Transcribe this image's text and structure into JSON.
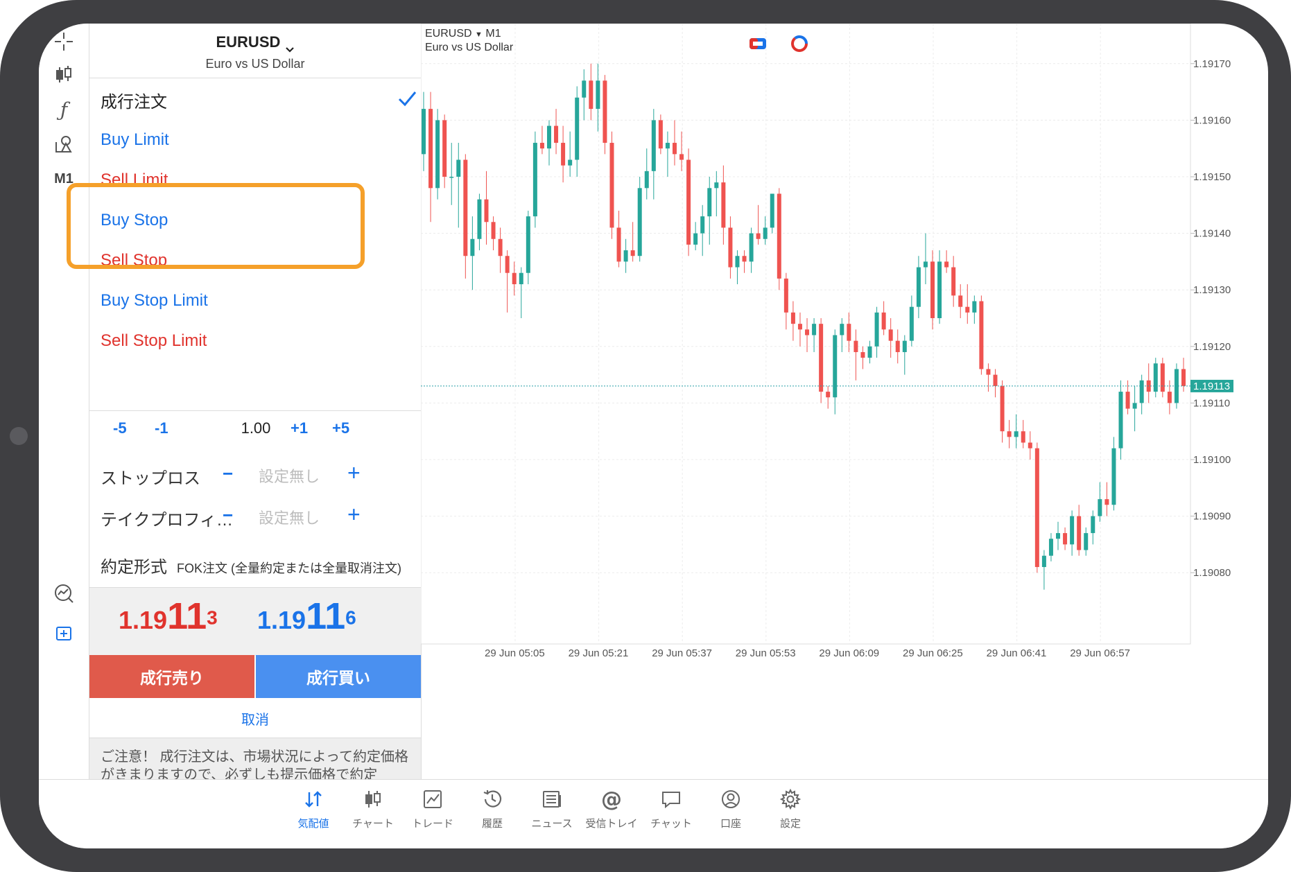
{
  "symbol": {
    "name": "EURUSD",
    "description": "Euro vs US Dollar"
  },
  "order_types": [
    {
      "label": "成行注文",
      "color": "dark",
      "selected": true
    },
    {
      "label": "Buy Limit",
      "color": "blue"
    },
    {
      "label": "Sell Limit",
      "color": "red"
    },
    {
      "label": "Buy Stop",
      "color": "blue"
    },
    {
      "label": "Sell Stop",
      "color": "red"
    },
    {
      "label": "Buy Stop Limit",
      "color": "blue"
    },
    {
      "label": "Sell Stop Limit",
      "color": "red"
    }
  ],
  "volume": {
    "minus5": "-5",
    "minus1": "-1",
    "value": "1.00",
    "plus1": "+1",
    "plus5": "+5"
  },
  "stop_loss": {
    "label": "ストップロス",
    "placeholder": "設定無し"
  },
  "take_profit": {
    "label": "テイクプロフィ…",
    "placeholder": "設定無し"
  },
  "fill_policy": {
    "label": "約定形式",
    "value": "FOK注文 (全量約定または全量取消注文)"
  },
  "bid": {
    "prefix": "1.19",
    "big": "11",
    "sup": "3"
  },
  "ask": {
    "prefix": "1.19",
    "big": "11",
    "sup": "6"
  },
  "buttons": {
    "sell": "成行売り",
    "buy": "成行買い",
    "cancel": "取消"
  },
  "notice": "ご注意！ 成行注文は、市場状況によって約定価格がきまりますので、必ずしも提示価格で約定",
  "chart": {
    "symbol": "EURUSD",
    "timeframe": "M1",
    "description": "Euro vs US Dollar",
    "current_price_label": "1.19113"
  },
  "toolbar": {
    "timeframe": "M1"
  },
  "colors": {
    "bull": "#26a69a",
    "bear": "#ef5350",
    "accent": "#1a73e8",
    "highlight": "#f5a02a"
  },
  "nav": [
    {
      "label": "気配値",
      "icon": "quotes-icon",
      "active": true
    },
    {
      "label": "チャート",
      "icon": "candles-icon"
    },
    {
      "label": "トレード",
      "icon": "trade-icon"
    },
    {
      "label": "履歴",
      "icon": "history-icon"
    },
    {
      "label": "ニュース",
      "icon": "news-icon"
    },
    {
      "label": "受信トレイ",
      "icon": "mail-icon"
    },
    {
      "label": "チャット",
      "icon": "chat-icon"
    },
    {
      "label": "口座",
      "icon": "account-icon"
    },
    {
      "label": "設定",
      "icon": "settings-icon"
    }
  ],
  "chart_data": {
    "type": "candlestick",
    "price_axis_labels": [
      "1.19170",
      "1.19160",
      "1.19150",
      "1.19140",
      "1.19130",
      "1.19120",
      "1.19110",
      "1.19100",
      "1.19090",
      "1.19080"
    ],
    "time_axis_labels": [
      "29 Jun 05:05",
      "29 Jun 05:21",
      "29 Jun 05:37",
      "29 Jun 05:53",
      "29 Jun 06:09",
      "29 Jun 06:25",
      "29 Jun 06:41",
      "29 Jun 06:57"
    ],
    "ylim": [
      1.19075,
      1.19175
    ],
    "last_price": 1.19113,
    "candles": [
      [
        1.19154,
        1.19165,
        1.19151,
        1.19162
      ],
      [
        1.19162,
        1.19165,
        1.19142,
        1.19148
      ],
      [
        1.19148,
        1.19162,
        1.19146,
        1.1916
      ],
      [
        1.1916,
        1.19161,
        1.19148,
        1.1915
      ],
      [
        1.1915,
        1.19156,
        1.19145,
        1.1915
      ],
      [
        1.1915,
        1.19156,
        1.19141,
        1.19153
      ],
      [
        1.19153,
        1.19154,
        1.19132,
        1.19136
      ],
      [
        1.19136,
        1.19143,
        1.1913,
        1.19139
      ],
      [
        1.19139,
        1.19147,
        1.19137,
        1.19146
      ],
      [
        1.19146,
        1.19151,
        1.19138,
        1.19142
      ],
      [
        1.19142,
        1.19143,
        1.19137,
        1.19139
      ],
      [
        1.19139,
        1.19141,
        1.19133,
        1.19136
      ],
      [
        1.19136,
        1.19137,
        1.19126,
        1.19133
      ],
      [
        1.19133,
        1.19135,
        1.19129,
        1.19131
      ],
      [
        1.19131,
        1.19134,
        1.19125,
        1.19133
      ],
      [
        1.19133,
        1.19144,
        1.19131,
        1.19143
      ],
      [
        1.19143,
        1.19158,
        1.19141,
        1.19156
      ],
      [
        1.19156,
        1.19159,
        1.19154,
        1.19155
      ],
      [
        1.19155,
        1.1916,
        1.19152,
        1.19159
      ],
      [
        1.19159,
        1.19162,
        1.19154,
        1.19156
      ],
      [
        1.19156,
        1.19159,
        1.19149,
        1.19152
      ],
      [
        1.19152,
        1.19158,
        1.1915,
        1.19153
      ],
      [
        1.19153,
        1.19166,
        1.1915,
        1.19164
      ],
      [
        1.19164,
        1.19169,
        1.1916,
        1.19167
      ],
      [
        1.19167,
        1.1917,
        1.1916,
        1.19162
      ],
      [
        1.19162,
        1.1917,
        1.19158,
        1.19167
      ],
      [
        1.19167,
        1.19168,
        1.19154,
        1.19156
      ],
      [
        1.19156,
        1.19158,
        1.19139,
        1.19141
      ],
      [
        1.19141,
        1.19144,
        1.19134,
        1.19135
      ],
      [
        1.19135,
        1.19139,
        1.19133,
        1.19137
      ],
      [
        1.19137,
        1.19142,
        1.19135,
        1.19136
      ],
      [
        1.19136,
        1.1915,
        1.19135,
        1.19148
      ],
      [
        1.19148,
        1.19155,
        1.19146,
        1.19151
      ],
      [
        1.19151,
        1.19162,
        1.19146,
        1.1916
      ],
      [
        1.1916,
        1.19161,
        1.19154,
        1.19155
      ],
      [
        1.19155,
        1.19158,
        1.1915,
        1.19156
      ],
      [
        1.19156,
        1.1916,
        1.19152,
        1.19154
      ],
      [
        1.19154,
        1.19158,
        1.19151,
        1.19153
      ],
      [
        1.19153,
        1.19155,
        1.19136,
        1.19138
      ],
      [
        1.19138,
        1.19142,
        1.19137,
        1.1914
      ],
      [
        1.1914,
        1.19145,
        1.19136,
        1.19143
      ],
      [
        1.19143,
        1.1915,
        1.19138,
        1.19148
      ],
      [
        1.19148,
        1.19151,
        1.19143,
        1.19149
      ],
      [
        1.19149,
        1.19152,
        1.19138,
        1.19141
      ],
      [
        1.19141,
        1.19143,
        1.19132,
        1.19134
      ],
      [
        1.19134,
        1.19137,
        1.19131,
        1.19136
      ],
      [
        1.19136,
        1.19137,
        1.19133,
        1.19135
      ],
      [
        1.19135,
        1.19141,
        1.19133,
        1.1914
      ],
      [
        1.1914,
        1.19145,
        1.19138,
        1.19139
      ],
      [
        1.19139,
        1.19143,
        1.19138,
        1.19141
      ],
      [
        1.19141,
        1.19147,
        1.1914,
        1.19147
      ],
      [
        1.19147,
        1.19148,
        1.1913,
        1.19132
      ],
      [
        1.19132,
        1.19133,
        1.19123,
        1.19126
      ],
      [
        1.19126,
        1.19128,
        1.19121,
        1.19124
      ],
      [
        1.19124,
        1.19126,
        1.1912,
        1.19123
      ],
      [
        1.19123,
        1.19125,
        1.19119,
        1.19122
      ],
      [
        1.19122,
        1.19125,
        1.19119,
        1.19124
      ],
      [
        1.19124,
        1.19125,
        1.1911,
        1.19112
      ],
      [
        1.19112,
        1.19113,
        1.19109,
        1.19111
      ],
      [
        1.19111,
        1.19123,
        1.19108,
        1.19122
      ],
      [
        1.19122,
        1.19125,
        1.19119,
        1.19124
      ],
      [
        1.19124,
        1.19126,
        1.19119,
        1.19121
      ],
      [
        1.19121,
        1.19123,
        1.19114,
        1.19119
      ],
      [
        1.19119,
        1.1912,
        1.19116,
        1.19118
      ],
      [
        1.19118,
        1.19121,
        1.19117,
        1.1912
      ],
      [
        1.1912,
        1.19127,
        1.19118,
        1.19126
      ],
      [
        1.19126,
        1.19128,
        1.19122,
        1.19123
      ],
      [
        1.19123,
        1.19125,
        1.19118,
        1.19121
      ],
      [
        1.19121,
        1.19123,
        1.19117,
        1.19119
      ],
      [
        1.19119,
        1.19122,
        1.19115,
        1.19121
      ],
      [
        1.19121,
        1.19129,
        1.1912,
        1.19127
      ],
      [
        1.19127,
        1.19136,
        1.19125,
        1.19134
      ],
      [
        1.19134,
        1.1914,
        1.19131,
        1.19135
      ],
      [
        1.19135,
        1.19137,
        1.19123,
        1.19125
      ],
      [
        1.19125,
        1.19137,
        1.19124,
        1.19135
      ],
      [
        1.19135,
        1.19137,
        1.19133,
        1.19134
      ],
      [
        1.19134,
        1.19136,
        1.19127,
        1.19129
      ],
      [
        1.19129,
        1.19131,
        1.19125,
        1.19127
      ],
      [
        1.19127,
        1.19131,
        1.19124,
        1.19126
      ],
      [
        1.19126,
        1.19129,
        1.19124,
        1.19128
      ],
      [
        1.19128,
        1.19129,
        1.19115,
        1.19116
      ],
      [
        1.19116,
        1.19117,
        1.19112,
        1.19115
      ],
      [
        1.19115,
        1.19116,
        1.19111,
        1.19113
      ],
      [
        1.19113,
        1.19114,
        1.19103,
        1.19105
      ],
      [
        1.19105,
        1.19107,
        1.19102,
        1.19104
      ],
      [
        1.19104,
        1.19108,
        1.19102,
        1.19105
      ],
      [
        1.19105,
        1.19107,
        1.19102,
        1.19103
      ],
      [
        1.19103,
        1.19105,
        1.191,
        1.19102
      ],
      [
        1.19102,
        1.19103,
        1.1908,
        1.19081
      ],
      [
        1.19081,
        1.19084,
        1.19077,
        1.19083
      ],
      [
        1.19083,
        1.19087,
        1.19082,
        1.19086
      ],
      [
        1.19086,
        1.19089,
        1.19084,
        1.19087
      ],
      [
        1.19087,
        1.19088,
        1.19084,
        1.19085
      ],
      [
        1.19085,
        1.19091,
        1.19083,
        1.1909
      ],
      [
        1.1909,
        1.19092,
        1.19083,
        1.19084
      ],
      [
        1.19084,
        1.19088,
        1.19083,
        1.19087
      ],
      [
        1.19087,
        1.19091,
        1.19085,
        1.1909
      ],
      [
        1.1909,
        1.19096,
        1.19089,
        1.19093
      ],
      [
        1.19093,
        1.19096,
        1.1909,
        1.19092
      ],
      [
        1.19092,
        1.19104,
        1.19091,
        1.19102
      ],
      [
        1.19102,
        1.19114,
        1.191,
        1.19112
      ],
      [
        1.19112,
        1.19114,
        1.19108,
        1.19109
      ],
      [
        1.19109,
        1.19113,
        1.19105,
        1.1911
      ],
      [
        1.1911,
        1.19115,
        1.19108,
        1.19114
      ],
      [
        1.19114,
        1.19117,
        1.1911,
        1.19112
      ],
      [
        1.19112,
        1.19118,
        1.19111,
        1.19117
      ],
      [
        1.19117,
        1.19118,
        1.19111,
        1.19112
      ],
      [
        1.19112,
        1.19114,
        1.19108,
        1.1911
      ],
      [
        1.1911,
        1.19117,
        1.19109,
        1.19116
      ],
      [
        1.19116,
        1.19118,
        1.19112,
        1.19113
      ]
    ]
  }
}
